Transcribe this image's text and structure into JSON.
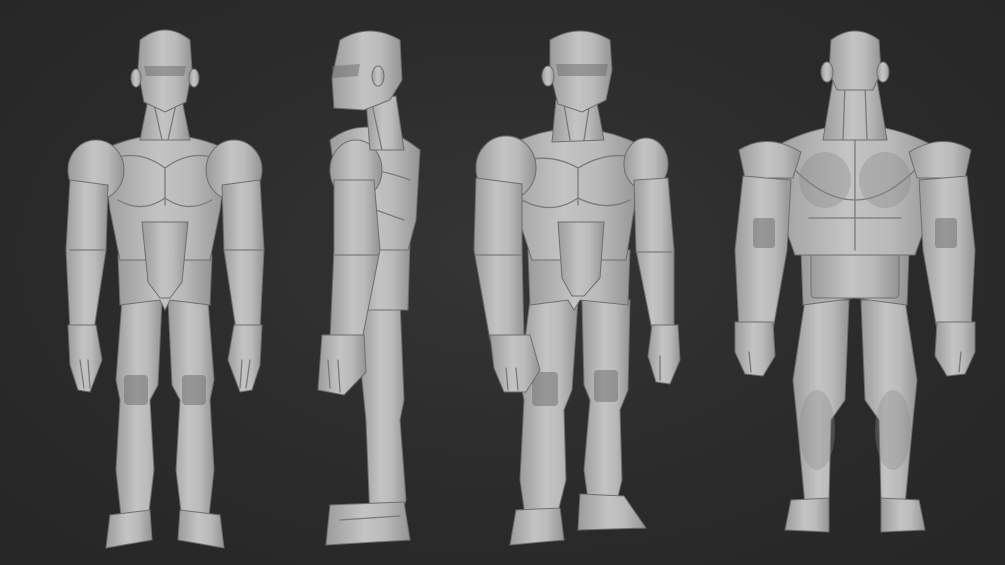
{
  "scene": {
    "background_color": "#2b2b2b",
    "material_color": "#b8b8b8",
    "views": [
      {
        "view": "front"
      },
      {
        "view": "side"
      },
      {
        "view": "three-quarter"
      },
      {
        "view": "back"
      }
    ]
  }
}
